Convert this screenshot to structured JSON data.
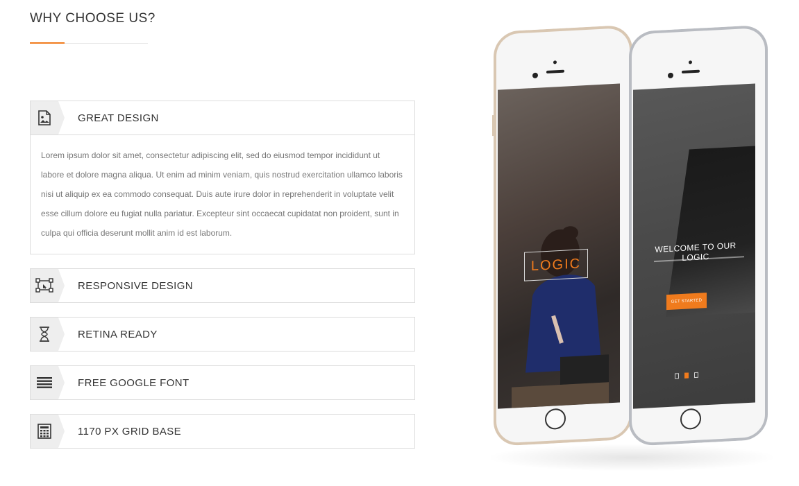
{
  "section": {
    "title": "WHY CHOOSE US?"
  },
  "accordion": {
    "items": [
      {
        "title": "GREAT DESIGN",
        "icon": "image-icon",
        "expanded": true,
        "body": "Lorem ipsum dolor sit amet, consectetur adipiscing elit, sed do eiusmod tempor incididunt ut labore et dolore magna aliqua. Ut enim ad minim veniam, quis nostrud exercitation ullamco laboris nisi ut aliquip ex ea commodo consequat. Duis aute irure dolor in reprehenderit in voluptate velit esse cillum dolore eu fugiat nulla pariatur. Excepteur sint occaecat cupidatat non proident, sunt in culpa qui officia deserunt mollit anim id est laborum."
      },
      {
        "title": "RESPONSIVE DESIGN",
        "icon": "vector-select-icon",
        "expanded": false
      },
      {
        "title": "RETINA READY",
        "icon": "hourglass-icon",
        "expanded": false
      },
      {
        "title": "FREE GOOGLE FONT",
        "icon": "text-lines-icon",
        "expanded": false
      },
      {
        "title": "1170 PX GRID BASE",
        "icon": "calculator-icon",
        "expanded": false
      }
    ]
  },
  "phones": {
    "left_screen": {
      "logo_text": "LOGIC"
    },
    "right_screen": {
      "headline": "WELCOME TO OUR LOGIC",
      "cta": "GET STARTED",
      "active_slide": 2,
      "slide_count": 3
    }
  },
  "colors": {
    "accent": "#f07b1d",
    "border": "#dcdcdc",
    "icon_bg": "#eeeeee",
    "text": "#333333",
    "body_text": "#777777"
  }
}
